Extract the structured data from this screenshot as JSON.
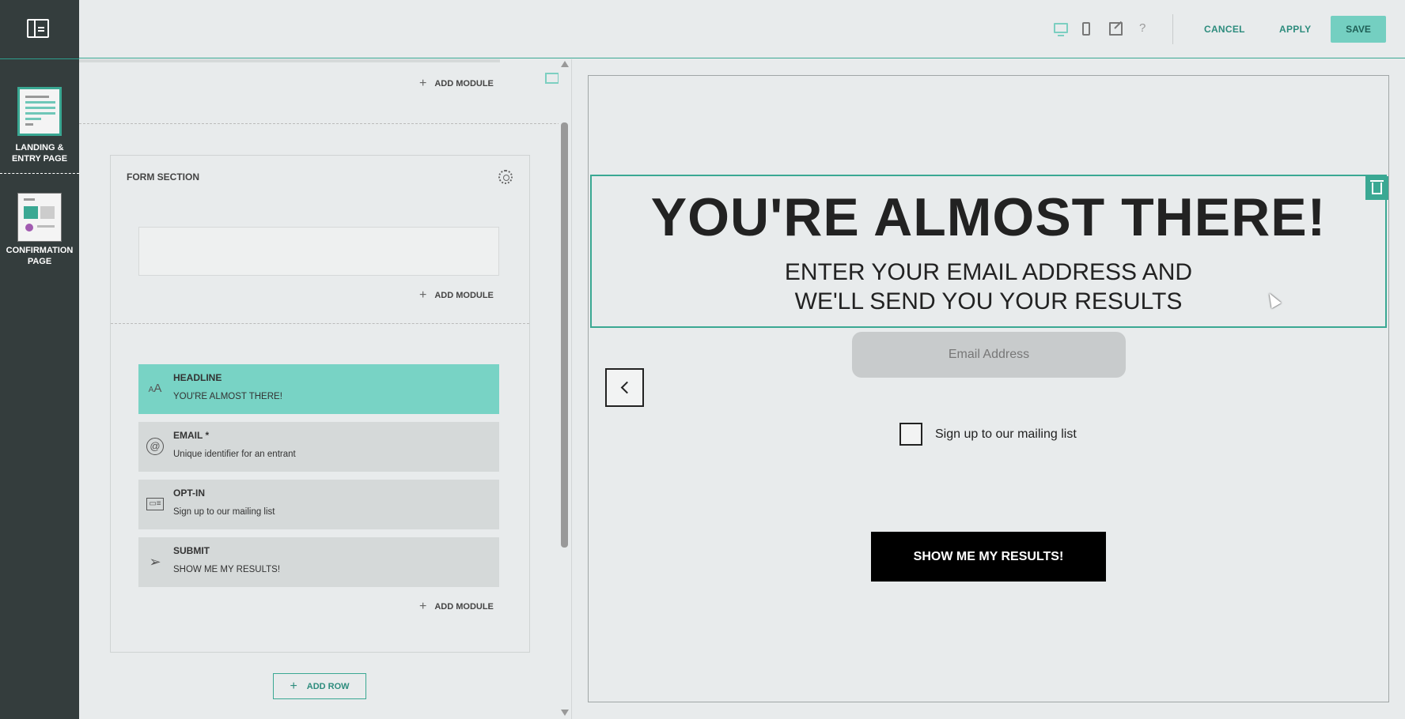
{
  "rail": {
    "pages": [
      {
        "label_line1": "LANDING &",
        "label_line2": "ENTRY PAGE",
        "active": true
      },
      {
        "label_line1": "CONFIRMATION",
        "label_line2": "PAGE",
        "active": false
      }
    ]
  },
  "toolbar": {
    "help_label": "?",
    "cancel_label": "CANCEL",
    "apply_label": "APPLY",
    "save_label": "SAVE"
  },
  "editor": {
    "top_add_module": "ADD MODULE",
    "form_section": {
      "title": "FORM SECTION",
      "add_module_1": "ADD MODULE",
      "modules": [
        {
          "title": "HEADLINE",
          "subtitle": "YOU'RE ALMOST THERE!",
          "icon": "text-size-icon",
          "active": true
        },
        {
          "title": "EMAIL *",
          "subtitle": "Unique identifier for an entrant",
          "icon": "at-sign-icon",
          "active": false
        },
        {
          "title": "OPT-IN",
          "subtitle": "Sign up to our mailing list",
          "icon": "opt-in-icon",
          "active": false
        },
        {
          "title": "SUBMIT",
          "subtitle": "SHOW ME MY RESULTS!",
          "icon": "paper-plane-icon",
          "active": false
        }
      ],
      "add_module_2": "ADD MODULE"
    },
    "add_row_label": "ADD ROW"
  },
  "preview": {
    "headline": "YOU'RE ALMOST THERE!",
    "subhead_line1": "ENTER YOUR EMAIL ADDRESS AND",
    "subhead_line2": "WE'LL SEND YOU YOUR RESULTS",
    "email_placeholder": "Email Address",
    "optin_label": "Sign up to our mailing list",
    "submit_label": "SHOW ME MY RESULTS!"
  },
  "colors": {
    "accent": "#3aa893",
    "accent_light": "#78d3c5",
    "rail_bg": "#343d3d",
    "page_bg": "#e8ebec"
  }
}
